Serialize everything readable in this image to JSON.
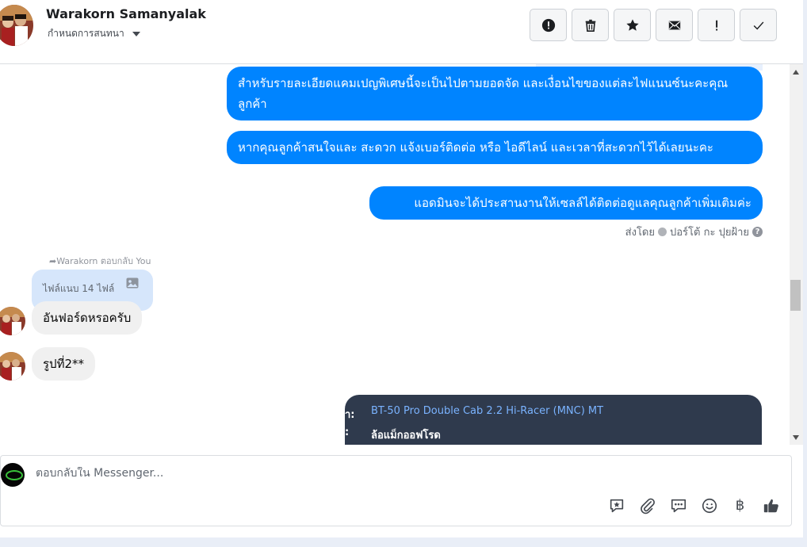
{
  "header": {
    "contact_name": "Warakorn Samanyalak",
    "subtitle": "กำหนดการสนทนา",
    "actions": [
      {
        "name": "report-button",
        "icon": "alert-circle-icon"
      },
      {
        "name": "delete-button",
        "icon": "trash-icon"
      },
      {
        "name": "star-button",
        "icon": "star-icon"
      },
      {
        "name": "mark-unread-button",
        "icon": "envelope-icon"
      },
      {
        "name": "important-button",
        "icon": "exclamation-icon"
      },
      {
        "name": "done-button",
        "icon": "checkmark-icon"
      }
    ]
  },
  "messages": {
    "outgoing": [
      "สำหรับรายละเอียดแคมเปญพิเศษนี้จะเป็นไปตามยอดจัด และเงื่อนไขของแต่ละไฟแนนซ์นะคะคุณลูกค้า",
      "หากคุณลูกค้าสนใจและ สะดวก แจ้งเบอร์ติดต่อ หรือ ไอดีไลน์ และเวลาที่สะดวกไว้ได้เลยนะคะ",
      "แอดมินจะได้ประสานงานให้เซลล์ได้ติดต่อดูแลคุณลูกค้าเพิ่มเติมค่ะ"
    ],
    "sent_by_prefix": "ส่งโดย",
    "sent_by_name": "ปอร์โต้ กะ ปุยฝ้าย",
    "reply_label": "Warakorn ตอบกลับ You",
    "reply_preview_text": "ไฟล์แนบ 14 ไฟล์",
    "incoming": [
      "อันฟอร์ดหรอครับ",
      "รูปที่2**"
    ],
    "card": {
      "label_1": "า:",
      "value_1": "BT-50 Pro Double Cab 2.2 Hi-Racer (MNC) MT",
      "label_2": ":",
      "value_2": "ล้อแม็กออฟโรด"
    }
  },
  "composer": {
    "placeholder": "ตอบกลับใน Messenger...",
    "tools": [
      "saved-reply-icon",
      "attachment-icon",
      "chat-bubbles-icon",
      "emoji-icon",
      "baht-icon",
      "thumbs-up-icon"
    ],
    "baht_symbol": "฿"
  },
  "colors": {
    "outgoing_bubble": "#0084ff",
    "incoming_bubble": "#f0f0f0",
    "card_bg": "#2f3a4d"
  }
}
